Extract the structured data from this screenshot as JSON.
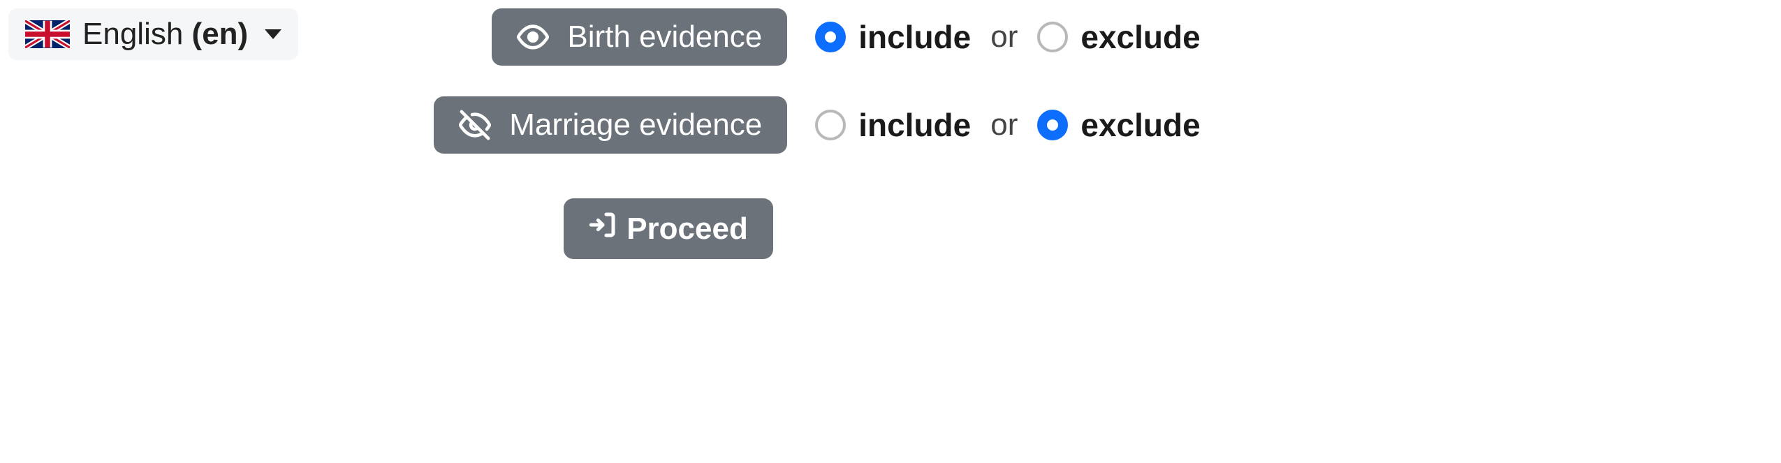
{
  "language": {
    "name": "English",
    "code": "(en)"
  },
  "evidence": [
    {
      "label": "Birth evidence",
      "include_label": "include",
      "exclude_label": "exclude",
      "or_label": "or",
      "selected": "include"
    },
    {
      "label": "Marriage evidence",
      "include_label": "include",
      "exclude_label": "exclude",
      "or_label": "or",
      "selected": "exclude"
    }
  ],
  "proceed_label": "Proceed"
}
